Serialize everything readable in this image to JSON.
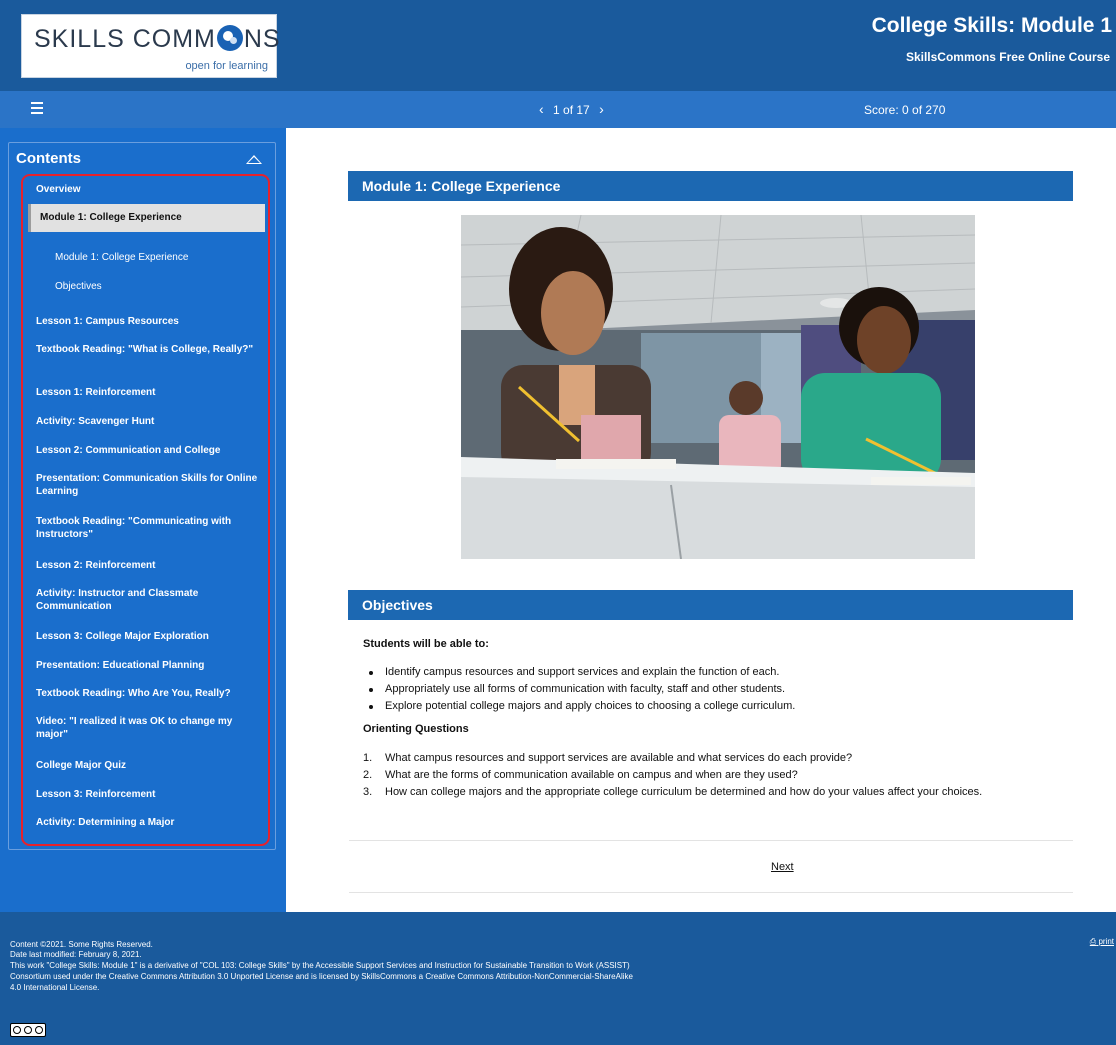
{
  "header": {
    "logo_text_left": "SKILLS COMM",
    "logo_text_right": "NS",
    "logo_tagline": "open for learning",
    "course_title": "College Skills: Module 1",
    "course_subtitle": "SkillsCommons Free Online Course"
  },
  "navbar": {
    "prev_symbol": "‹",
    "page_indicator": "1 of 17",
    "next_symbol": "›",
    "score": "Score: 0 of 270"
  },
  "sidebar": {
    "contents_title": "Contents",
    "items": [
      {
        "label": "Overview"
      },
      {
        "label": "Module 1: College Experience"
      },
      {
        "label": "Module 1: College Experience"
      },
      {
        "label": "Objectives"
      },
      {
        "label": "Lesson 1: Campus Resources"
      },
      {
        "label": "Textbook Reading: \"What is College, Really?\""
      },
      {
        "label": "Lesson 1: Reinforcement"
      },
      {
        "label": "Activity: Scavenger Hunt"
      },
      {
        "label": "Lesson 2: Communication and College"
      },
      {
        "label": "Presentation: Communication Skills for Online Learning"
      },
      {
        "label": "Textbook Reading: \"Communicating with Instructors\""
      },
      {
        "label": "Lesson 2: Reinforcement"
      },
      {
        "label": "Activity: Instructor and Classmate Communication"
      },
      {
        "label": "Lesson 3: College Major Exploration"
      },
      {
        "label": "Presentation: Educational Planning"
      },
      {
        "label": "Textbook Reading: Who Are You, Really?"
      },
      {
        "label": "Video: \"I realized it was OK to change my major\""
      },
      {
        "label": "College Major Quiz"
      },
      {
        "label": "Lesson 3: Reinforcement"
      },
      {
        "label": "Activity: Determining a Major"
      }
    ]
  },
  "main": {
    "section1_title": "Module 1: College Experience",
    "section2_title": "Objectives",
    "students_heading": "Students will be able to:",
    "bullets": [
      "Identify campus resources and support services and explain the function of each.",
      "Appropriately use all forms of communication with faculty, staff and other students.",
      "Explore potential college majors and apply choices to choosing a college curriculum."
    ],
    "orienting_heading": "Orienting Questions",
    "questions": [
      {
        "num": "1.",
        "text": "What campus resources and support services are available and what services do each provide?"
      },
      {
        "num": "2.",
        "text": "What are the forms of communication available on campus and when are they used?"
      },
      {
        "num": "3.",
        "text": "How can college majors and the appropriate college curriculum be determined and how do your values affect your choices."
      }
    ],
    "next_label": "Next"
  },
  "footer": {
    "lines": [
      "Content ©2021. Some Rights Reserved.",
      "Date last modified: February 8, 2021.",
      "This work \"College Skills: Module 1\" is a derivative of \"COL 103: College Skills\" by the Accessible Support Services and Instruction for Sustainable Transition to Work (ASSIST)",
      "Consortium used under the Creative Commons Attribution 3.0 Unported License and is licensed by SkillsCommons a Creative Commons Attribution-NonCommercial-ShareAlike",
      "4.0 International License."
    ],
    "print_label": "print",
    "cc_badge_text": "BY NC SA"
  },
  "colors": {
    "header_bg": "#1a5a9c",
    "navbar_bg": "#2b74c7",
    "sidebar_bg": "#1a6ecc",
    "section_bar": "#1c68b2",
    "highlight_frame": "#e8212b"
  }
}
